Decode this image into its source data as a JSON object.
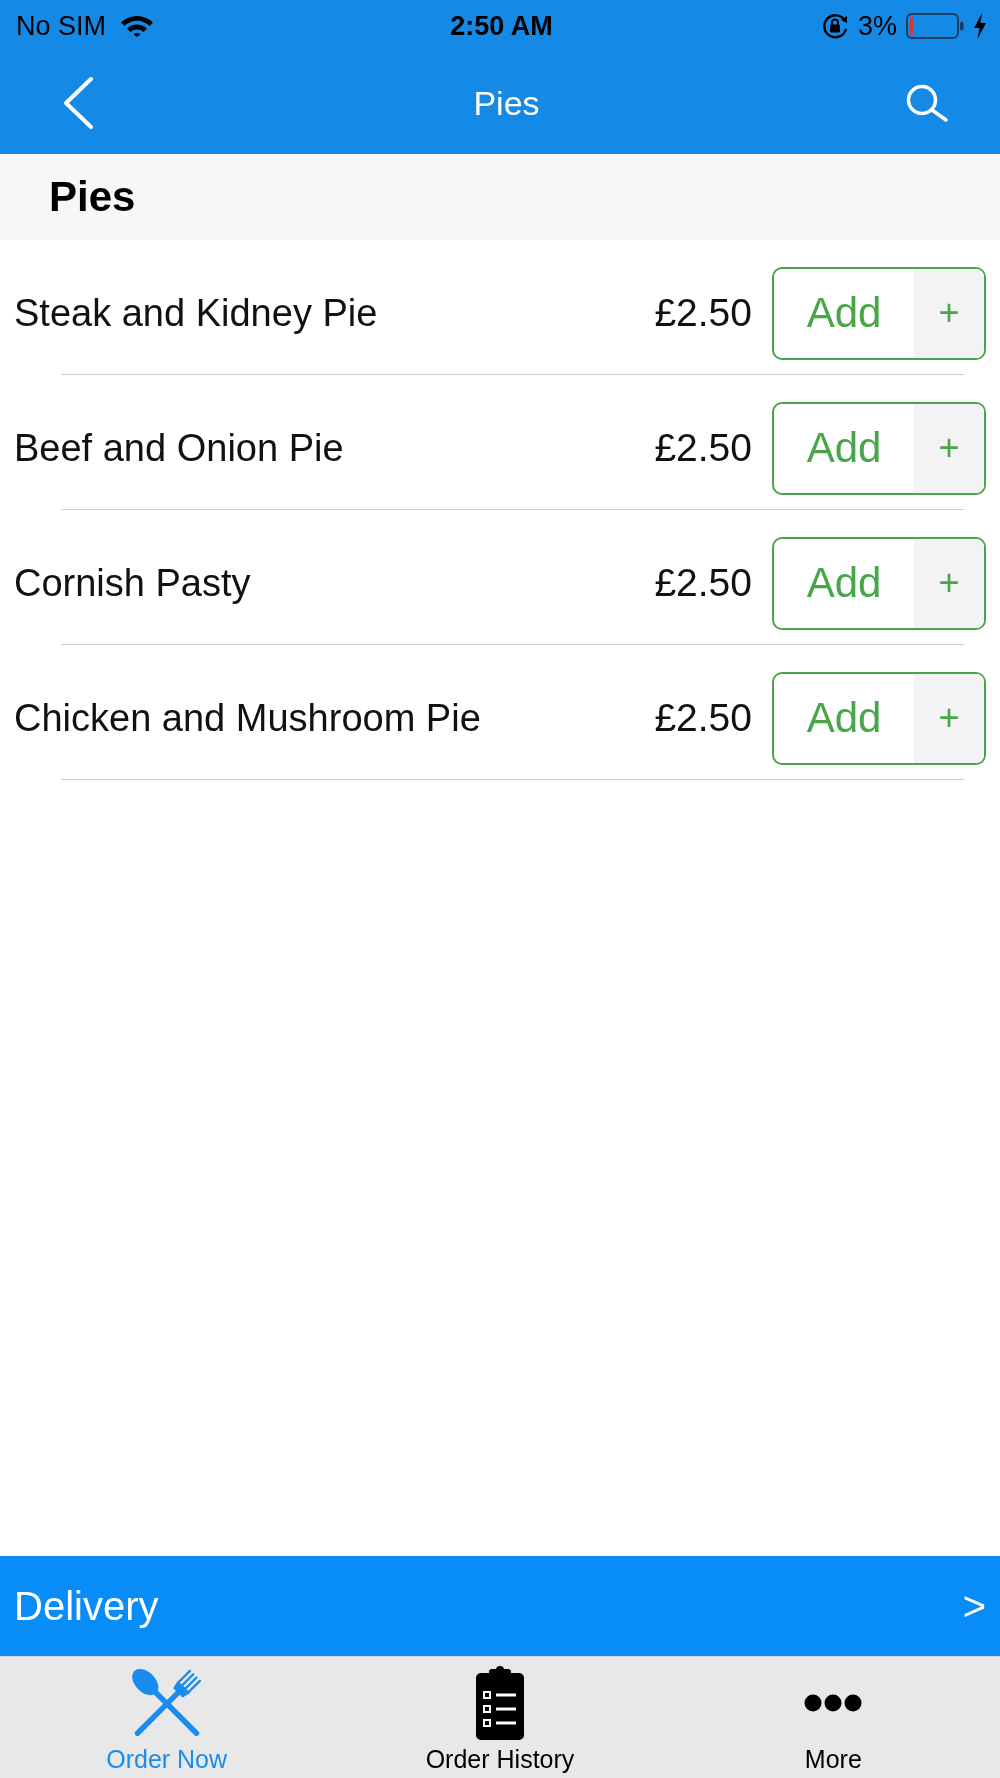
{
  "status_bar": {
    "carrier": "No SIM",
    "time": "2:50 AM",
    "battery_percent": "3%"
  },
  "nav_bar": {
    "title": "Pies"
  },
  "section": {
    "title": "Pies"
  },
  "items": [
    {
      "name": "Steak and Kidney Pie",
      "price": "£2.50",
      "button_label": "Add",
      "button_symbol": "+"
    },
    {
      "name": "Beef and Onion Pie",
      "price": "£2.50",
      "button_label": "Add",
      "button_symbol": "+"
    },
    {
      "name": "Cornish Pasty",
      "price": "£2.50",
      "button_label": "Add",
      "button_symbol": "+"
    },
    {
      "name": "Chicken and Mushroom Pie",
      "price": "£2.50",
      "button_label": "Add",
      "button_symbol": "+"
    }
  ],
  "delivery_bar": {
    "label": "Delivery",
    "arrow": ">"
  },
  "tabs": [
    {
      "label": "Order Now",
      "kind": "cutlery",
      "selected": true
    },
    {
      "label": "Order History",
      "kind": "clipboard",
      "selected": false
    },
    {
      "label": "More",
      "kind": "more",
      "selected": false
    }
  ]
}
